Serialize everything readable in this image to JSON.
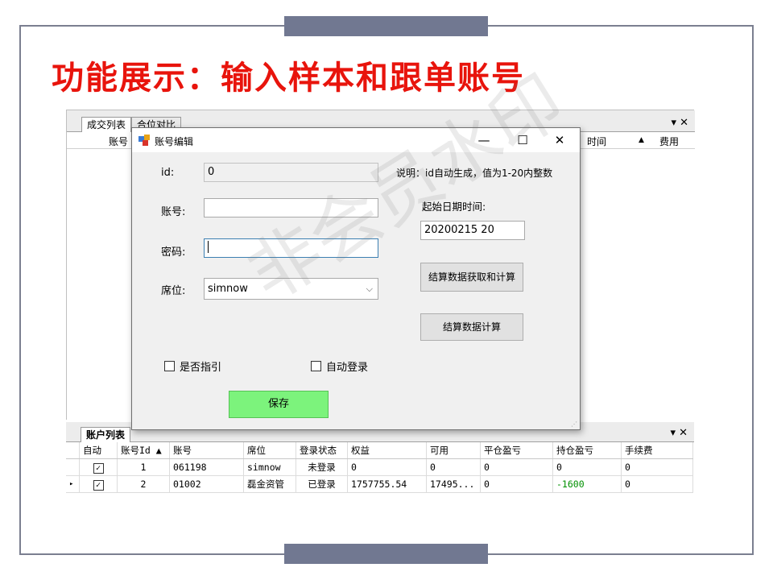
{
  "slide": {
    "title": "功能展示：输入样本和跟单账号"
  },
  "main_tabs": [
    "成交列表",
    "合位对比"
  ],
  "main_grid_headers": [
    "账号",
    "时间",
    "费用"
  ],
  "pane_controls": "▾ ✕",
  "dialog": {
    "title": "账号编辑",
    "minimize": "—",
    "maximize": "☐",
    "close": "✕",
    "id_label": "id:",
    "id_value": "0",
    "account_label": "账号:",
    "account_value": "",
    "password_label": "密码:",
    "password_value": "",
    "seat_label": "席位:",
    "seat_value": "simnow",
    "note": "说明：id自动生成，值为1-20内整数",
    "start_label": "起始日期时间:",
    "start_value": "20200215 20",
    "btn_fetch_calc": "结算数据获取和计算",
    "btn_calc": "结算数据计算",
    "cb_guide": "是否指引",
    "cb_autologin": "自动登录",
    "btn_save": "保存"
  },
  "bottom_tab": "账户列表",
  "accounts": {
    "headers": [
      "自动",
      "账号Id ▲",
      "账号",
      "席位",
      "登录状态",
      "权益",
      "可用",
      "平仓盈亏",
      "持仓盈亏",
      "手续费"
    ],
    "rows": [
      {
        "marker": "",
        "auto": "✓",
        "id": "1",
        "account": "061198",
        "seat": "simnow",
        "status": "未登录",
        "equity": "0",
        "available": "0",
        "close_pnl": "0",
        "pos_pnl": "0",
        "fee": "0"
      },
      {
        "marker": "▸",
        "auto": "✓",
        "id": "2",
        "account": "01002",
        "seat": "磊金资管",
        "status": "已登录",
        "equity": "1757755.54",
        "available": "17495...",
        "close_pnl": "0",
        "pos_pnl": "-1600",
        "fee": "0"
      }
    ]
  },
  "watermark": "非会员水印",
  "colors": {
    "title_red": "#e8140c",
    "frame": "#7b7f90",
    "bar": "#717891",
    "save_green": "#7cf37c",
    "pnl_green": "#009000"
  }
}
